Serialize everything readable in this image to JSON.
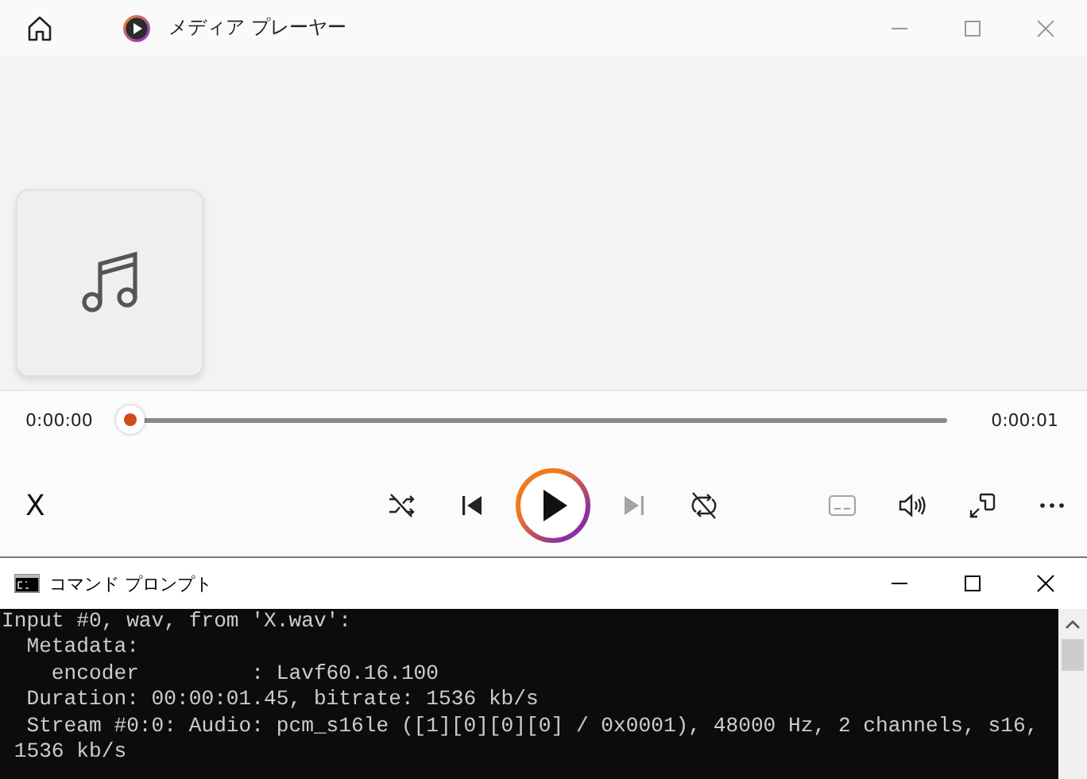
{
  "player_window": {
    "title": "メディア プレーヤー"
  },
  "progress": {
    "elapsed": "0:00:00",
    "total": "0:00:01",
    "level": 0
  },
  "now_playing": {
    "title": "X"
  },
  "controls": [
    {
      "kind": "shuffle",
      "disabled": false
    },
    {
      "kind": "previous",
      "disabled": false
    },
    {
      "kind": "play",
      "disabled": false
    },
    {
      "kind": "next",
      "disabled": true
    },
    {
      "kind": "repeat",
      "disabled": false
    }
  ],
  "side_controls": [
    {
      "kind": "captions",
      "disabled": true
    },
    {
      "kind": "volume",
      "disabled": false
    },
    {
      "kind": "mini-player",
      "disabled": false
    },
    {
      "kind": "more",
      "disabled": false
    }
  ],
  "console_window": {
    "title": "コマンド プロンプト",
    "lines": [
      "Input #0, wav, from 'X.wav':",
      "  Metadata:",
      "    encoder         : Lavf60.16.100",
      "  Duration: 00:00:01.45, bitrate: 1536 kb/s",
      "  Stream #0:0: Audio: pcm_s16le ([1][0][0][0] / 0x0001), 48000 Hz, 2 channels, s16,",
      " 1536 kb/s"
    ]
  }
}
